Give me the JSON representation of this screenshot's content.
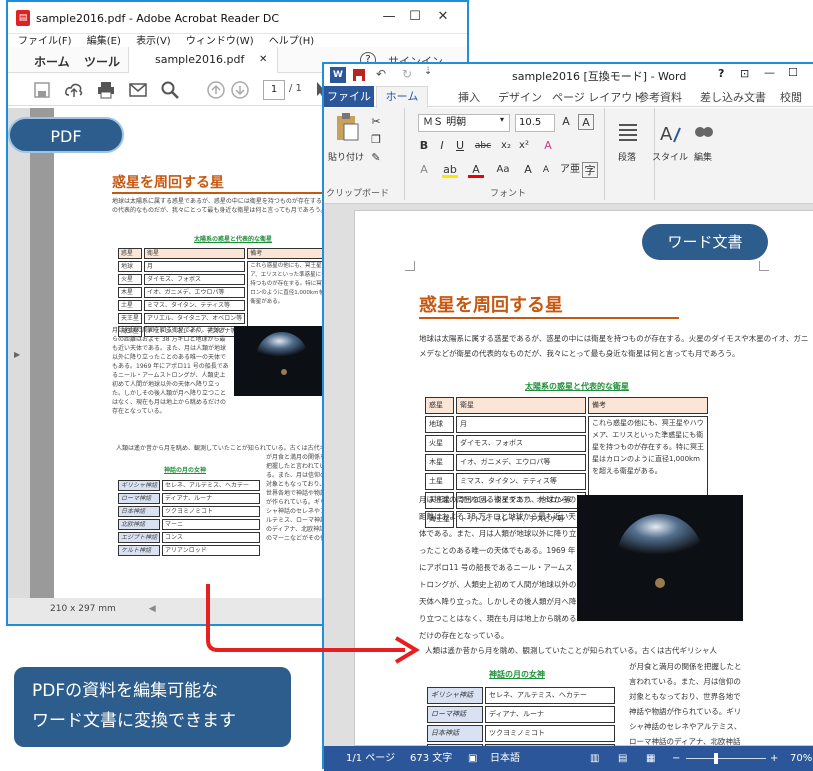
{
  "acrobat": {
    "title": "sample2016.pdf - Adobe Acrobat Reader DC",
    "menu": [
      "ファイル(F)",
      "編集(E)",
      "表示(V)",
      "ウィンドウ(W)",
      "ヘルプ(H)"
    ],
    "tabs": {
      "home": "ホーム",
      "tools": "ツール",
      "file": "sample2016.pdf",
      "help": "?",
      "signin": "サインイン"
    },
    "page_current": "1",
    "page_total": "/ 1",
    "page_size": "210 x 297 mm"
  },
  "pdf_badge": "PDF",
  "word_badge": "ワード文書",
  "caption": {
    "line1": "PDFの資料を編集可能な",
    "line2": "ワード文書に変換できます"
  },
  "word": {
    "title": "sample2016 [互換モード] - Word",
    "help": "?",
    "file_tab": "ファイル",
    "tabs": [
      "ホーム",
      "挿入",
      "デザイン",
      "ページ レイアウト",
      "参考資料",
      "差し込み文書",
      "校閲"
    ],
    "font_name": "ＭＳ 明朝",
    "font_size": "10.5",
    "paste_label": "貼り付け",
    "clipboard_label": "クリップボード",
    "font_group_label": "フォント",
    "paragraph_label": "段落",
    "style_label": "スタイル",
    "edit_label": "編集",
    "status": {
      "page": "1/1 ページ",
      "words": "673 文字",
      "lang": "日本語",
      "zoom": "70%"
    }
  },
  "document": {
    "title": "惑星を周回する星",
    "intro": "地球は太陽系に属する惑星であるが、惑星の中には衛星を持つものが存在する。火星のダイモスや木星のイオ、ガニメデなどが衛星の代表的なものだが、我々にとって最も身近な衛星は何と言っても月であろう。",
    "table_caption": "太陽系の惑星と代表的な衛星",
    "table_head": [
      "惑星",
      "衛星",
      "備考"
    ],
    "table_rows": [
      [
        "地球",
        "月"
      ],
      [
        "火星",
        "ダイモス、フォボス"
      ],
      [
        "木星",
        "イオ、ガニメデ、エウロパ等"
      ],
      [
        "土星",
        "ミマス、タイタン、テティス等"
      ],
      [
        "天王星",
        "アリエル、タイタニア、オベロン等"
      ],
      [
        "海王星",
        "トリトン、ネレイド、デスピナ等"
      ]
    ],
    "table_note": "これら惑星の他にも、冥王星やハウメア、エリスといった準惑星にも衛星を持つものが存在する。特に冥王星はカロンのように直径1,000kmを超える衛星がある。",
    "moon_para": "月は地球の周囲を回る衛星であり、地球からの距離はおよそ 38 万キロと地球から最も近い天体である。また、月は人類が地球以外に降り立ったことのある唯一の天体でもある。1969 年にアポロ11 号の船長であるニール・アームストロングが、人類史上初めて人間が地球以外の天体へ降り立った。しかしその後人類が月へ降り立つことはなく、現在も月は地上から眺めるだけの存在となっている。",
    "watch_para": "人類は遙か昔から月を眺め、観測していたことが知られている。古くは古代ギリシャ人",
    "myth_caption": "神話の月の女神",
    "myth_rows": [
      [
        "ギリシャ神話",
        "セレネ、アルテミス、ヘカテー"
      ],
      [
        "ローマ神話",
        "ディアナ、ルーナ"
      ],
      [
        "日本神話",
        "ツクヨミノミコト"
      ],
      [
        "北欧神話",
        "マーニ"
      ],
      [
        "エジプト神話",
        "コンス"
      ],
      [
        "ケルト神話",
        "アリアンロッド"
      ]
    ],
    "myth_para": "が月食と満月の関係を把握したと言われている。また、月は信仰の対象ともなっており、世界各地で神話や物語が作られている。ギリシャ神話のセレネやアルテミス、ローマ神話のディアナ、北欧神話のマーニなどがその代表格と言えるであろう。"
  }
}
